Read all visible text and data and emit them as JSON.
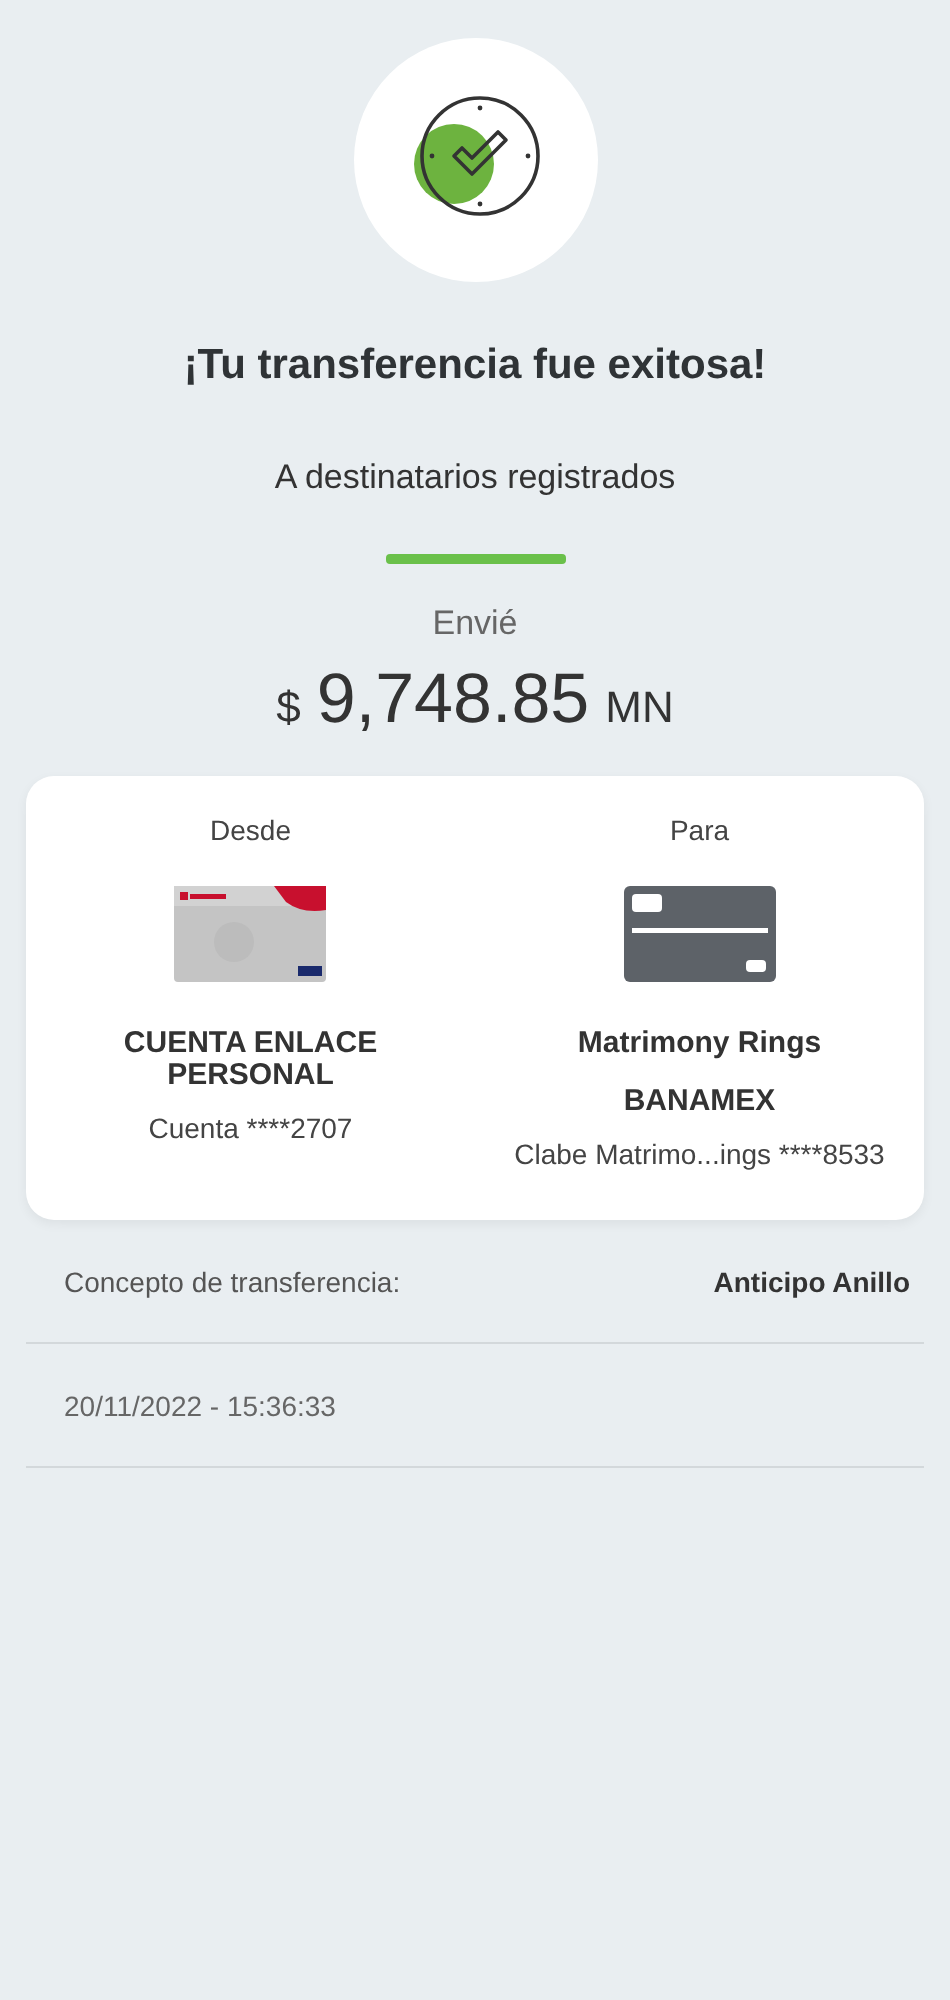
{
  "title": "¡Tu transferencia fue exitosa!",
  "subtitle": "A destinatarios registrados",
  "amount": {
    "label": "Envié",
    "currency": "$",
    "value": "9,748.85",
    "unit": "MN"
  },
  "accounts": [
    {
      "heading": "Desde",
      "kind": "picture",
      "name": "CUENTA ENLACE PERSONAL",
      "detail": "Cuenta ****2707"
    },
    {
      "heading": "Para",
      "kind": "generic",
      "name": "Matrimony Rings",
      "bank": "BANAMEX",
      "detail": "Clabe Matrimo...ings ****8533"
    }
  ],
  "concept": {
    "label": "Concepto de transferencia:",
    "value": "Anticipo Anillo"
  },
  "datetime": "20/11/2022 - 15:36:33"
}
